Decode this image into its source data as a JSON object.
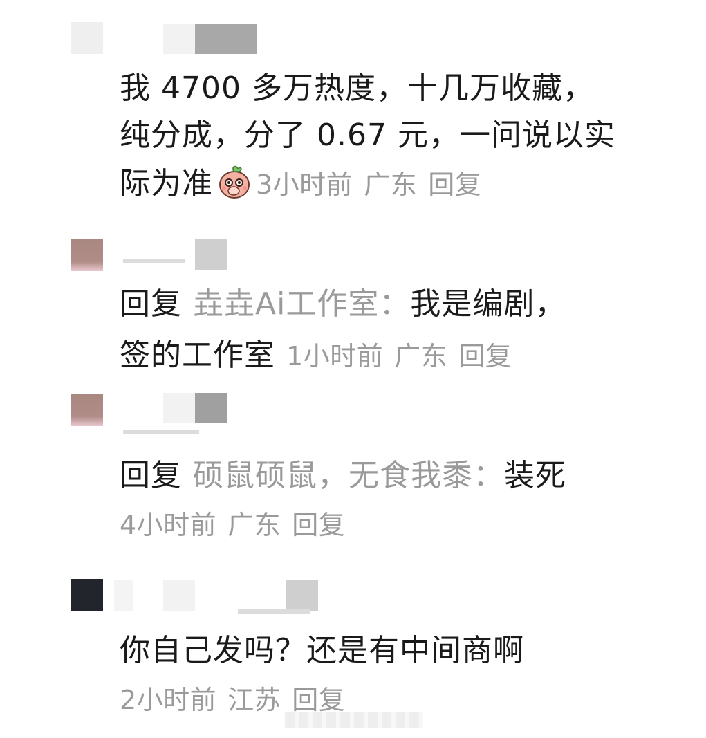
{
  "comments": [
    {
      "text_line1": "我 4700 多万热度，十几万收藏，",
      "text_line2": "纯分成，分了 0.67 元，一问说以实",
      "text_line3": "际为准",
      "emoji": "peach-face-emoji",
      "time": "3小时前",
      "location": "广东",
      "reply": "回复"
    },
    {
      "reply_prefix": "回复",
      "reply_to": "垚垚Ai工作室：",
      "text_line1": "我是编剧，",
      "text_line2": "签的工作室",
      "time": "1小时前",
      "location": "广东",
      "reply": "回复"
    },
    {
      "reply_prefix": "回复",
      "reply_to": "硕鼠硕鼠，无食我黍：",
      "text_line1": "装死",
      "time": "4小时前",
      "location": "广东",
      "reply": "回复"
    },
    {
      "text_line1": "你自己发吗？还是有中间商啊",
      "time": "2小时前",
      "location": "江苏",
      "reply": "回复"
    }
  ]
}
